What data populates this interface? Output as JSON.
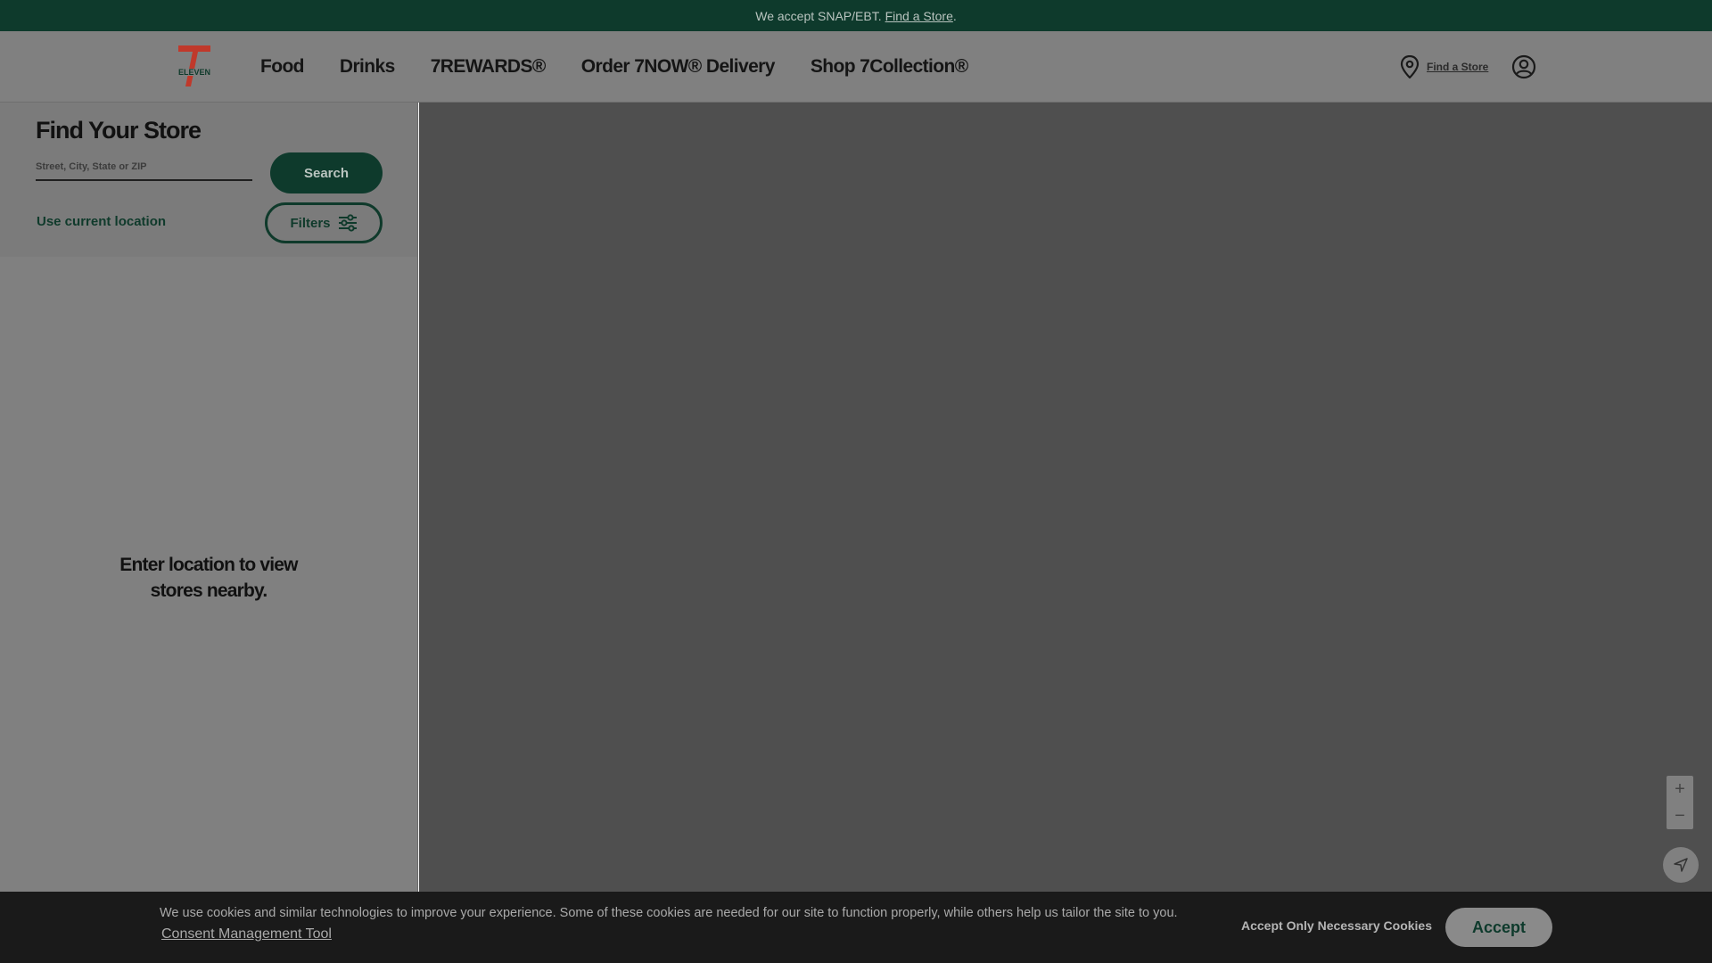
{
  "banner": {
    "text": "We accept SNAP/EBT.",
    "link": "Find a Store",
    "suffix": "."
  },
  "header": {
    "logo_text": "ELEVEN",
    "nav": [
      "Food",
      "Drinks",
      "7REWARDS®",
      "Order 7NOW® Delivery",
      "Shop 7Collection®"
    ],
    "find_store": "Find a Store",
    "icons": {
      "location": "location-pin-icon",
      "account": "account-icon"
    }
  },
  "store_finder": {
    "title": "Find Your Store",
    "search_placeholder": "Street, City, State or ZIP",
    "search_value": "",
    "search_button": "Search",
    "use_location": "Use current location",
    "filters_button": "Filters",
    "empty_line1": "Enter location to view",
    "empty_line2": "stores nearby."
  },
  "map": {
    "zoom_in": "+",
    "zoom_out": "−"
  },
  "cookie": {
    "text": "We use cookies and similar technologies to improve your experience. Some of these cookies are needed for our site to function properly, while others help us tailor the site to you.",
    "consent_link": "Consent Management Tool",
    "necessary": "Accept Only Necessary Cookies",
    "accept": "Accept"
  },
  "colors": {
    "brand_green": "#0e3a2c",
    "map_overlay": "#4f4f4f",
    "cookie_bg": "#1a1a1a"
  }
}
